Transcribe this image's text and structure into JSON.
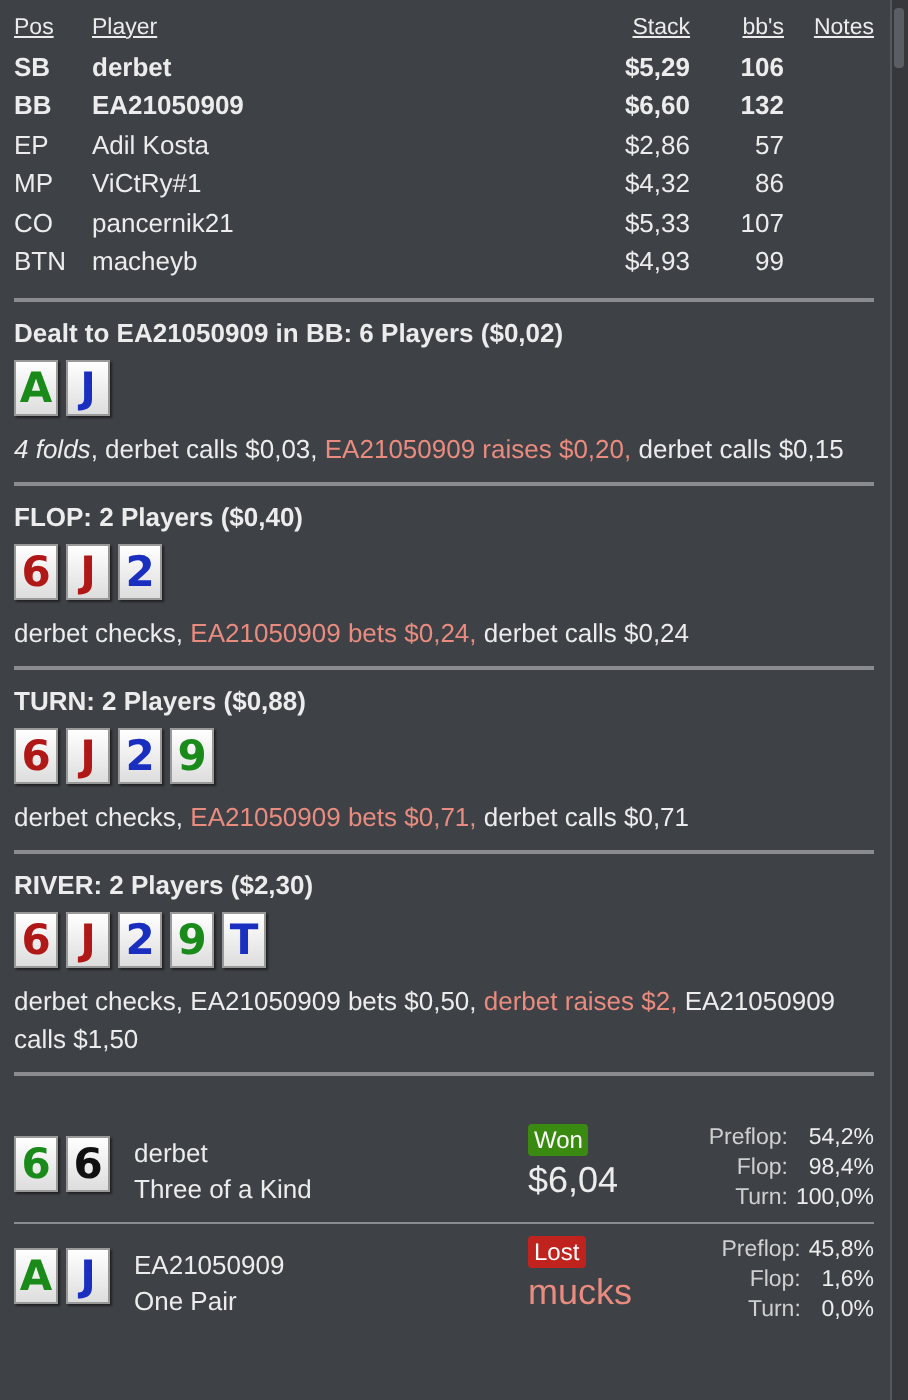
{
  "players_table": {
    "columns": [
      "Pos",
      "Player",
      "Stack",
      "bb's",
      "Notes"
    ],
    "rows": [
      {
        "pos": "SB",
        "player": "derbet",
        "stack": "$5,29",
        "bbs": "106",
        "in_hand": true
      },
      {
        "pos": "BB",
        "player": "EA21050909",
        "stack": "$6,60",
        "bbs": "132",
        "in_hand": true
      },
      {
        "pos": "EP",
        "player": "Adil Kosta",
        "stack": "$2,86",
        "bbs": "57",
        "in_hand": false
      },
      {
        "pos": "MP",
        "player": "ViCtRy#1",
        "stack": "$4,32",
        "bbs": "86",
        "in_hand": false
      },
      {
        "pos": "CO",
        "player": "pancernik21",
        "stack": "$5,33",
        "bbs": "107",
        "in_hand": false
      },
      {
        "pos": "BTN",
        "player": "macheyb",
        "stack": "$4,93",
        "bbs": "99",
        "in_hand": false
      }
    ]
  },
  "streets": [
    {
      "title": "Dealt to EA21050909 in BB: 6 Players ($0,02)",
      "cards": [
        {
          "rank": "A",
          "color": "#1a8a1a"
        },
        {
          "rank": "J",
          "color": "#1a2fc0"
        }
      ],
      "actions": [
        {
          "text": "*4 folds*, derbet calls $0,03, ",
          "hero": false
        },
        {
          "text": "EA21050909 raises $0,20, ",
          "hero": true
        },
        {
          "text": "derbet calls $0,15",
          "hero": false
        }
      ]
    },
    {
      "title": "FLOP: 2 Players ($0,40)",
      "cards": [
        {
          "rank": "6",
          "color": "#b01818"
        },
        {
          "rank": "J",
          "color": "#b01818"
        },
        {
          "rank": "2",
          "color": "#1a2fc0"
        }
      ],
      "actions": [
        {
          "text": "derbet checks, ",
          "hero": false
        },
        {
          "text": "EA21050909 bets $0,24, ",
          "hero": true
        },
        {
          "text": "derbet calls $0,24",
          "hero": false
        }
      ]
    },
    {
      "title": "TURN: 2 Players ($0,88)",
      "cards": [
        {
          "rank": "6",
          "color": "#b01818"
        },
        {
          "rank": "J",
          "color": "#b01818"
        },
        {
          "rank": "2",
          "color": "#1a2fc0"
        },
        {
          "rank": "9",
          "color": "#1a8a1a"
        }
      ],
      "actions": [
        {
          "text": "derbet checks, ",
          "hero": false
        },
        {
          "text": "EA21050909 bets $0,71, ",
          "hero": true
        },
        {
          "text": "derbet calls $0,71",
          "hero": false
        }
      ]
    },
    {
      "title": "RIVER: 2 Players ($2,30)",
      "cards": [
        {
          "rank": "6",
          "color": "#b01818"
        },
        {
          "rank": "J",
          "color": "#b01818"
        },
        {
          "rank": "2",
          "color": "#1a2fc0"
        },
        {
          "rank": "9",
          "color": "#1a8a1a"
        },
        {
          "rank": "T",
          "color": "#1a2fc0"
        }
      ],
      "actions": [
        {
          "text": "derbet checks, EA21050909 bets $0,50, ",
          "hero": false
        },
        {
          "text": "derbet raises $2, ",
          "hero": true
        },
        {
          "text": "EA21050909 calls $1,50",
          "hero": false
        }
      ]
    }
  ],
  "showdown": [
    {
      "cards": [
        {
          "rank": "6",
          "color": "#1a8a1a"
        },
        {
          "rank": "6",
          "color": "#111111"
        }
      ],
      "player": "derbet",
      "hand": "Three of a Kind",
      "result": "Won",
      "won": true,
      "amount": "$6,04",
      "equity": [
        {
          "label": "Preflop:",
          "value": "54,2%"
        },
        {
          "label": "Flop:",
          "value": "98,4%"
        },
        {
          "label": "Turn:",
          "value": "100,0%"
        }
      ]
    },
    {
      "cards": [
        {
          "rank": "A",
          "color": "#1a8a1a"
        },
        {
          "rank": "J",
          "color": "#1a2fc0"
        }
      ],
      "player": "EA21050909",
      "hand": "One Pair",
      "result": "Lost",
      "won": false,
      "amount": "mucks",
      "equity": [
        {
          "label": "Preflop:",
          "value": "45,8%"
        },
        {
          "label": "Flop:",
          "value": "1,6%"
        },
        {
          "label": "Turn:",
          "value": "0,0%"
        }
      ]
    }
  ]
}
